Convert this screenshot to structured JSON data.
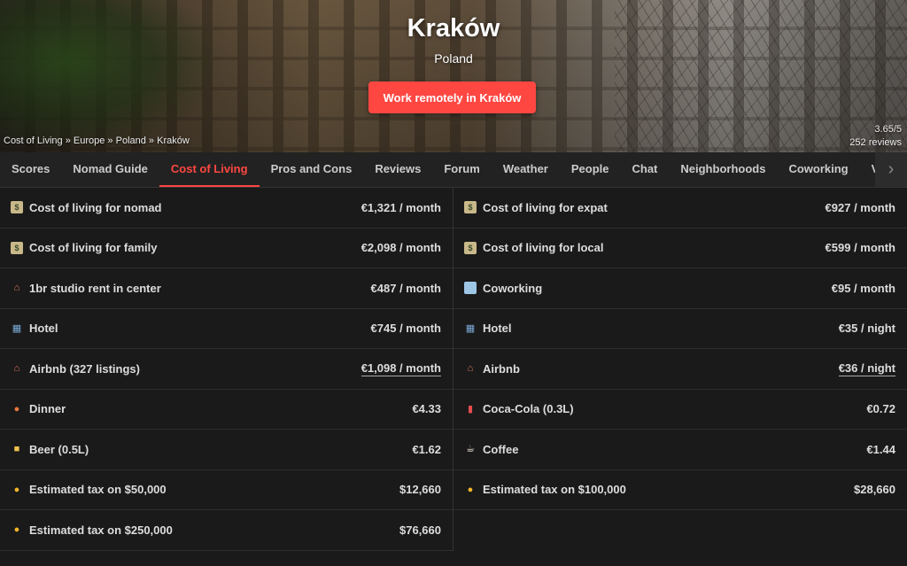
{
  "hero": {
    "city": "Kraków",
    "country": "Poland",
    "cta_label": "Work remotely in Kraków",
    "breadcrumb": [
      "Cost of Living",
      "Europe",
      "Poland",
      "Kraków"
    ],
    "breadcrumb_sep": " » ",
    "rating": "3.65/5",
    "reviews": "252 reviews"
  },
  "tabs": {
    "active": "Cost of Living",
    "items": [
      "Scores",
      "Nomad Guide",
      "Cost of Living",
      "Pros and Cons",
      "Reviews",
      "Forum",
      "Weather",
      "People",
      "Chat",
      "Neighborhoods",
      "Coworking",
      "Vi"
    ],
    "next_icon": "chevron-right-icon"
  },
  "costs": {
    "left": [
      {
        "icon": "money-icon",
        "label": "Cost of living for nomad",
        "value": "€1,321 / month"
      },
      {
        "icon": "money-icon",
        "label": "Cost of living for family",
        "value": "€2,098 / month"
      },
      {
        "icon": "house-icon",
        "label": "1br studio rent in center",
        "value": "€487 / month"
      },
      {
        "icon": "hotel-icon",
        "label": "Hotel",
        "value": "€745 / month"
      },
      {
        "icon": "house-icon",
        "label": "Airbnb (327 listings)",
        "value": "€1,098 / month"
      },
      {
        "icon": "pizza-icon",
        "label": "Dinner",
        "value": "€4.33"
      },
      {
        "icon": "beer-icon",
        "label": "Beer (0.5L)",
        "value": "€1.62"
      },
      {
        "icon": "moneybag-icon",
        "label": "Estimated tax on $50,000",
        "value": "$12,660"
      },
      {
        "icon": "moneybag-icon",
        "label": "Estimated tax on $250,000",
        "value": "$76,660"
      }
    ],
    "right": [
      {
        "icon": "money-icon",
        "label": "Cost of living for expat",
        "value": "€927 / month"
      },
      {
        "icon": "money-icon",
        "label": "Cost of living for local",
        "value": "€599 / month"
      },
      {
        "icon": "coworking-icon",
        "label": "Coworking",
        "value": "€95 / month"
      },
      {
        "icon": "hotel-icon",
        "label": "Hotel",
        "value": "€35 / night"
      },
      {
        "icon": "house-icon",
        "label": "Airbnb",
        "value": "€36 / night"
      },
      {
        "icon": "cola-icon",
        "label": "Coca-Cola (0.3L)",
        "value": "€0.72"
      },
      {
        "icon": "coffee-icon",
        "label": "Coffee",
        "value": "€1.44"
      },
      {
        "icon": "moneybag-icon",
        "label": "Estimated tax on $100,000",
        "value": "$28,660"
      }
    ]
  },
  "colors": {
    "accent": "#ff4742",
    "background": "#1a1a1a",
    "tab_bar": "#222222"
  }
}
